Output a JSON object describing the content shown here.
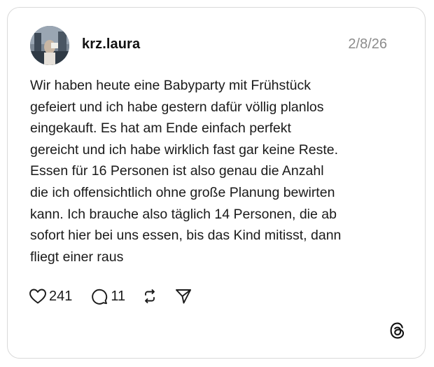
{
  "post": {
    "username": "krz.laura",
    "date": "2/8/26",
    "text_lines": [
      "Wir haben heute eine Babyparty mit Frühstück",
      "gefeiert und ich habe gestern dafür völlig planlos",
      "eingekauft. Es hat am Ende einfach perfekt",
      "gereicht und ich habe wirklich fast gar keine Reste.",
      "Essen für 16 Personen ist also genau die Anzahl",
      "die ich offensichtlich ohne große Planung bewirten",
      "kann. Ich brauche also täglich 14 Personen, die ab",
      "sofort hier bei uns essen, bis das Kind mitisst, dann",
      "fliegt einer raus"
    ],
    "likes": "241",
    "replies": "11"
  },
  "icons": {
    "like": "heart-icon",
    "reply": "comment-bubble-icon",
    "repost": "repost-icon",
    "share": "send-icon",
    "brand": "threads-logo-icon"
  },
  "colors": {
    "text": "#1a1a1a",
    "muted": "#8c8c8c",
    "border": "#d9d9d9"
  }
}
